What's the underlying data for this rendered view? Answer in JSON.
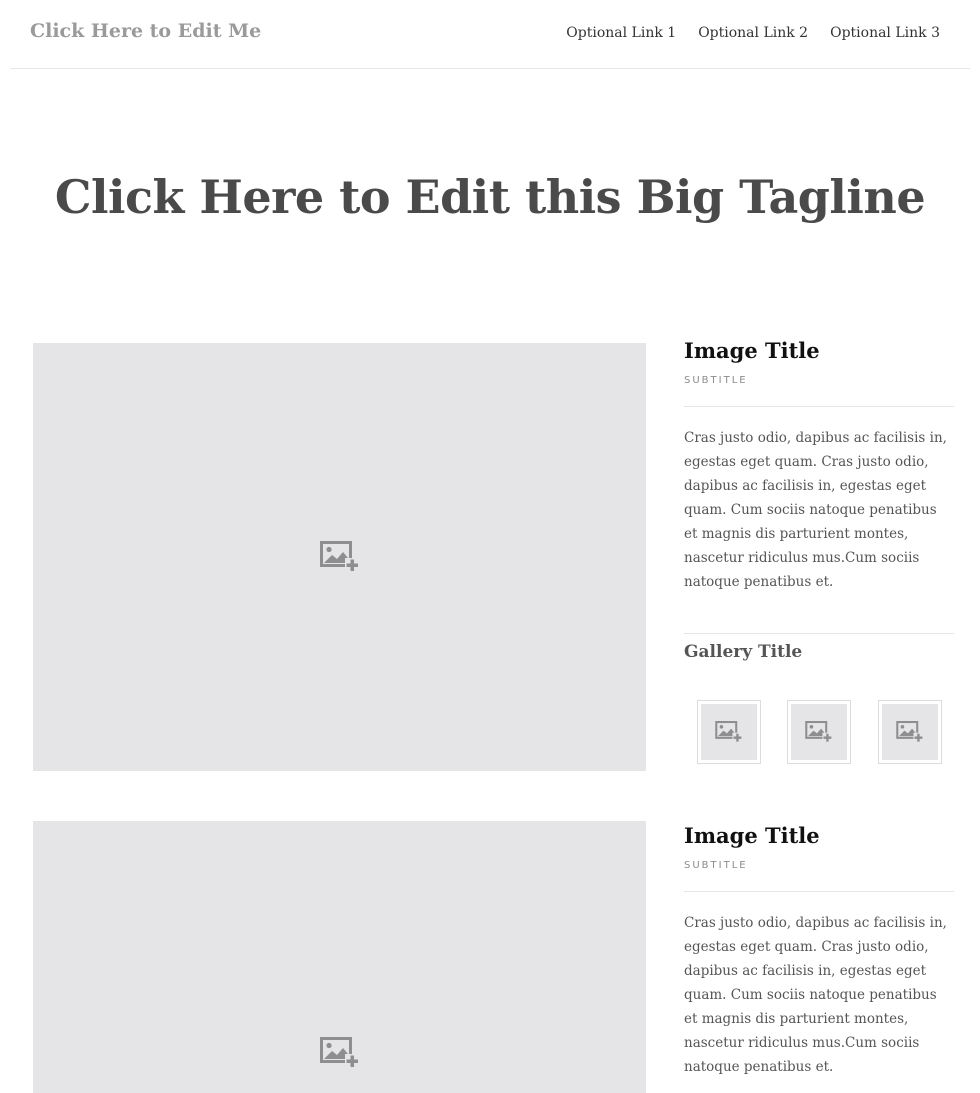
{
  "header": {
    "site_title": "Click Here to Edit Me",
    "links": [
      "Optional Link 1",
      "Optional Link 2",
      "Optional Link 3"
    ]
  },
  "hero": {
    "tagline": "Click Here to Edit this Big Tagline"
  },
  "sections": [
    {
      "image_icon": "add-image-icon",
      "title": "Image Title",
      "subtitle": "SUBTITLE",
      "body": "Cras justo odio, dapibus ac facilisis in, egestas eget quam. Cras justo odio, dapibus ac facilisis in, egestas eget quam. Cum sociis natoque penatibus et magnis dis parturient montes, nascetur ridiculus mus.Cum sociis natoque penatibus et."
    },
    {
      "image_icon": "add-image-icon",
      "title": "Image Title",
      "subtitle": "SUBTITLE",
      "body": "Cras justo odio, dapibus ac facilisis in, egestas eget quam. Cras justo odio, dapibus ac facilisis in, egestas eget quam. Cum sociis natoque penatibus et magnis dis parturient montes, nascetur ridiculus mus.Cum sociis natoque penatibus et."
    }
  ],
  "gallery": {
    "title": "Gallery Title",
    "thumbnail_icon": "add-image-icon",
    "thumbnail_count": 3
  },
  "colors": {
    "placeholder_bg": "#e5e5e7",
    "icon_gray": "#8e8e90",
    "site_title": "#9a9a9a",
    "tagline": "#4a4a4a"
  }
}
